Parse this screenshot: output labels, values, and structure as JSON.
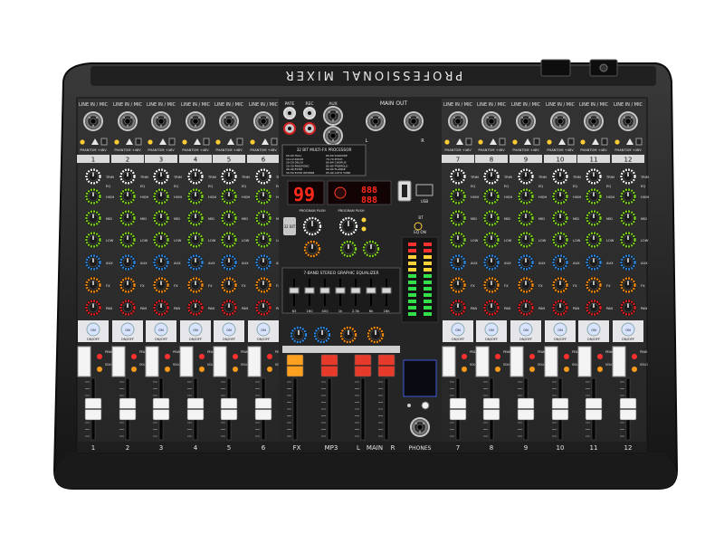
{
  "device": {
    "brand_strip": "PROFESSIONAL MIXER",
    "input_section_label": "LINE IN / MIC",
    "phantom_label": "PHANTOM +48V",
    "knob_labels": [
      "TRIM",
      "EQ",
      "HIGH",
      "MID",
      "LOW",
      "AUX",
      "FX",
      "PAN"
    ],
    "on_off_label": "ON/OFF",
    "peak_label": "PEAK",
    "solo_label": "SOLO",
    "channel_numbers_left": [
      "1",
      "2",
      "3",
      "4",
      "5",
      "6"
    ],
    "channel_numbers_right": [
      "7",
      "8",
      "9",
      "10",
      "11",
      "12"
    ],
    "bottom_labels": {
      "fx": "FX",
      "mp3": "MP3",
      "main_l": "L",
      "main": "MAIN",
      "main_r": "R",
      "phones": "PHONES"
    },
    "center": {
      "rca_labels": [
        "PATE",
        "REC",
        "AUX"
      ],
      "main_out_label": "MAIN OUT",
      "main_out_lr": [
        "L",
        "R"
      ],
      "fx_processor_title": "32 BIT MULTI-FX PROCESSOR",
      "fx_presets_left": [
        "00-09 HALL",
        "10-19 ROOM",
        "20-29 DELAY",
        "30-39 PINGPONG",
        "40-49 ECHO",
        "50-59 ECHO REVERB"
      ],
      "fx_presets_right": [
        "60-69 KARAOKE",
        "70-79 PITCH",
        "80-84 CHORUS",
        "85-89 TREMOLO",
        "90-94 FLANGE",
        "95-99 AUTO TUNE"
      ],
      "fx_display_value": "99",
      "usb_display_value": "888",
      "usb_label": "USB",
      "bt_label": "BT",
      "program_label_left": "PROGRAM PUSH",
      "program_label_right": "PROGRAM PUSH",
      "eq_on_label": "EQ ON",
      "geq_title": "7-BAND STEREO GRAPHIC EQUALIZER",
      "geq_bands": [
        "63",
        "160",
        "400",
        "1k",
        "2.5k",
        "6k",
        "16k"
      ],
      "badge": "32 BIT"
    }
  },
  "colors": {
    "panel": "#2b2b2b",
    "frame": "#1b1b1b",
    "knob_green": "#7fd021",
    "knob_blue": "#2d88e0",
    "knob_orange": "#f08a12",
    "knob_red": "#e02020",
    "knob_white": "#f2f2f2",
    "fader_white": "#f4f4f4",
    "fader_orange": "#ffa020",
    "fader_red": "#e83a2a",
    "led_green": "#34e04a",
    "led_yellow": "#ffd23a",
    "led_red": "#ff3030"
  }
}
